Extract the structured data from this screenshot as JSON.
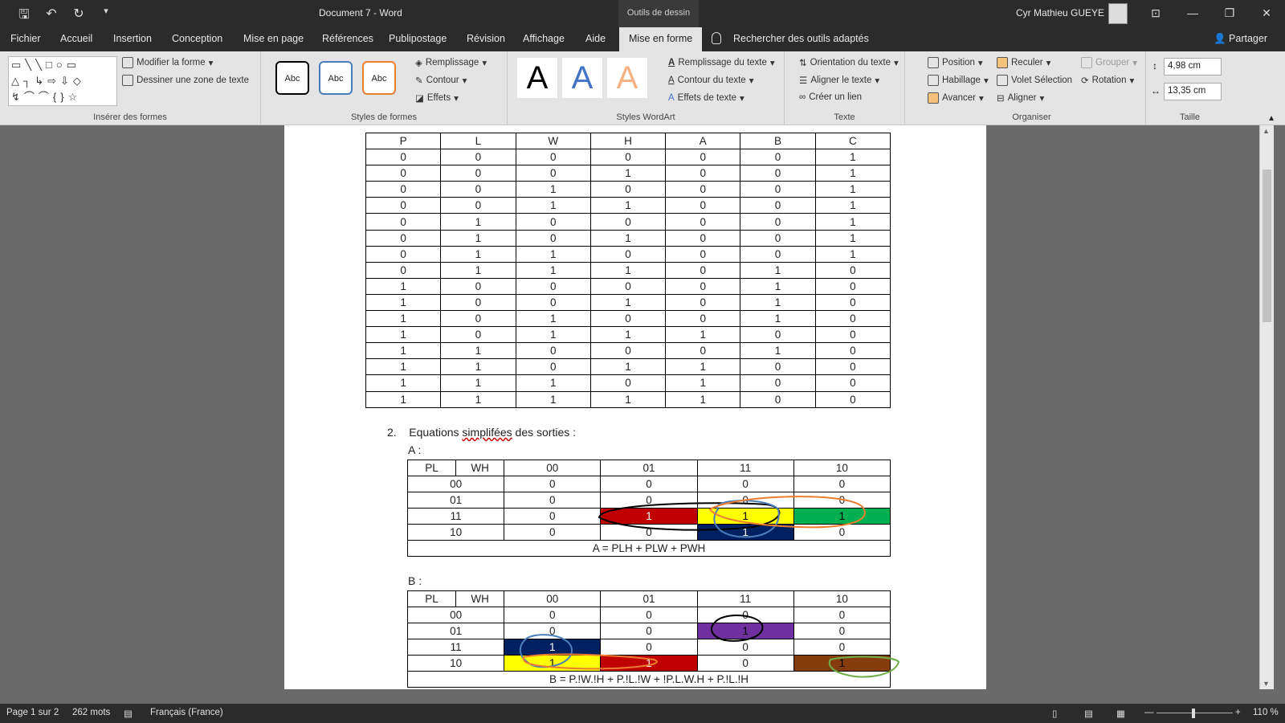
{
  "titlebar": {
    "quick_access": [
      "save-icon",
      "undo-icon",
      "redo-icon",
      "customize-icon"
    ],
    "document_title": "Document 7 - Word",
    "context_tools": "Outils de dessin",
    "user": "Cyr Mathieu GUEYE"
  },
  "tabs": [
    "Fichier",
    "Accueil",
    "Insertion",
    "Conception",
    "Mise en page",
    "Références",
    "Publipostage",
    "Révision",
    "Affichage",
    "Aide",
    "Mise en forme"
  ],
  "tell_me": "Rechercher des outils adaptés",
  "share": "Partager",
  "ribbon": {
    "insert_shapes": {
      "label": "Insérer des formes",
      "edit_shape": "Modifier la forme",
      "draw_textbox": "Dessiner une zone de texte"
    },
    "shape_styles": {
      "label": "Styles de formes",
      "samples": [
        "Abc",
        "Abc",
        "Abc"
      ],
      "fill": "Remplissage",
      "outline": "Contour",
      "effects": "Effets"
    },
    "wordart_styles": {
      "label": "Styles WordArt",
      "samples": [
        "A",
        "A",
        "A"
      ],
      "text_fill": "Remplissage du texte",
      "text_outline": "Contour du texte",
      "text_effects": "Effets de texte"
    },
    "text": {
      "label": "Texte",
      "direction": "Orientation du texte",
      "align": "Aligner le texte",
      "link": "Créer un lien"
    },
    "arrange": {
      "label": "Organiser",
      "position": "Position",
      "wrap": "Habillage",
      "forward": "Avancer",
      "backward": "Reculer",
      "selection_pane": "Volet Sélection",
      "align": "Aligner",
      "group": "Grouper",
      "rotate": "Rotation"
    },
    "size": {
      "label": "Taille",
      "height": "4,98 cm",
      "width": "13,35 cm"
    }
  },
  "document": {
    "truth_table": {
      "headers": [
        "P",
        "L",
        "W",
        "H",
        "A",
        "B",
        "C"
      ],
      "rows": [
        [
          "0",
          "0",
          "0",
          "0",
          "0",
          "0",
          "1"
        ],
        [
          "0",
          "0",
          "0",
          "1",
          "0",
          "0",
          "1"
        ],
        [
          "0",
          "0",
          "1",
          "0",
          "0",
          "0",
          "1"
        ],
        [
          "0",
          "0",
          "1",
          "1",
          "0",
          "0",
          "1"
        ],
        [
          "0",
          "1",
          "0",
          "0",
          "0",
          "0",
          "1"
        ],
        [
          "0",
          "1",
          "0",
          "1",
          "0",
          "0",
          "1"
        ],
        [
          "0",
          "1",
          "1",
          "0",
          "0",
          "0",
          "1"
        ],
        [
          "0",
          "1",
          "1",
          "1",
          "0",
          "1",
          "0"
        ],
        [
          "1",
          "0",
          "0",
          "0",
          "0",
          "1",
          "0"
        ],
        [
          "1",
          "0",
          "0",
          "1",
          "0",
          "1",
          "0"
        ],
        [
          "1",
          "0",
          "1",
          "0",
          "0",
          "1",
          "0"
        ],
        [
          "1",
          "0",
          "1",
          "1",
          "1",
          "0",
          "0"
        ],
        [
          "1",
          "1",
          "0",
          "0",
          "0",
          "1",
          "0"
        ],
        [
          "1",
          "1",
          "0",
          "1",
          "1",
          "0",
          "0"
        ],
        [
          "1",
          "1",
          "1",
          "0",
          "1",
          "0",
          "0"
        ],
        [
          "1",
          "1",
          "1",
          "1",
          "1",
          "0",
          "0"
        ]
      ]
    },
    "section_number": "2.",
    "section_title_pre": "Equations ",
    "section_title_underlined": "simplifées",
    "section_title_post": " des sorties :",
    "kmap_a": {
      "label": "A :",
      "row_var": "PL",
      "col_var": "WH",
      "cols": [
        "00",
        "01",
        "11",
        "10"
      ],
      "rows": [
        {
          "key": "00",
          "cells": [
            "0",
            "0",
            "0",
            "0"
          ]
        },
        {
          "key": "01",
          "cells": [
            "0",
            "0",
            "0",
            "0"
          ]
        },
        {
          "key": "11",
          "cells": [
            "0",
            "1",
            "1",
            "1"
          ]
        },
        {
          "key": "10",
          "cells": [
            "0",
            "0",
            "1",
            "0"
          ]
        }
      ],
      "equation": "A = PLH + PLW + PWH",
      "highlights": {
        "red": "#c00000",
        "yellow": "#ffff00",
        "green": "#00b050",
        "navy": "#002060"
      }
    },
    "kmap_b": {
      "label": "B :",
      "row_var": "PL",
      "col_var": "WH",
      "cols": [
        "00",
        "01",
        "11",
        "10"
      ],
      "rows": [
        {
          "key": "00",
          "cells": [
            "0",
            "0",
            "0",
            "0"
          ]
        },
        {
          "key": "01",
          "cells": [
            "0",
            "0",
            "1",
            "0"
          ]
        },
        {
          "key": "11",
          "cells": [
            "1",
            "0",
            "0",
            "0"
          ]
        },
        {
          "key": "10",
          "cells": [
            "1",
            "1",
            "0",
            "1"
          ]
        }
      ],
      "equation": "B = P.!W.!H + P.!L.!W + !P.L.W.H + P.!L.!H",
      "highlights": {
        "purple": "#7030a0",
        "navy": "#002060",
        "yellow": "#ffff00",
        "red": "#c00000",
        "brown": "#843c0c"
      }
    }
  },
  "status": {
    "page": "Page 1 sur 2",
    "words": "262 mots",
    "language": "Français (France)",
    "zoom": "110 %"
  }
}
